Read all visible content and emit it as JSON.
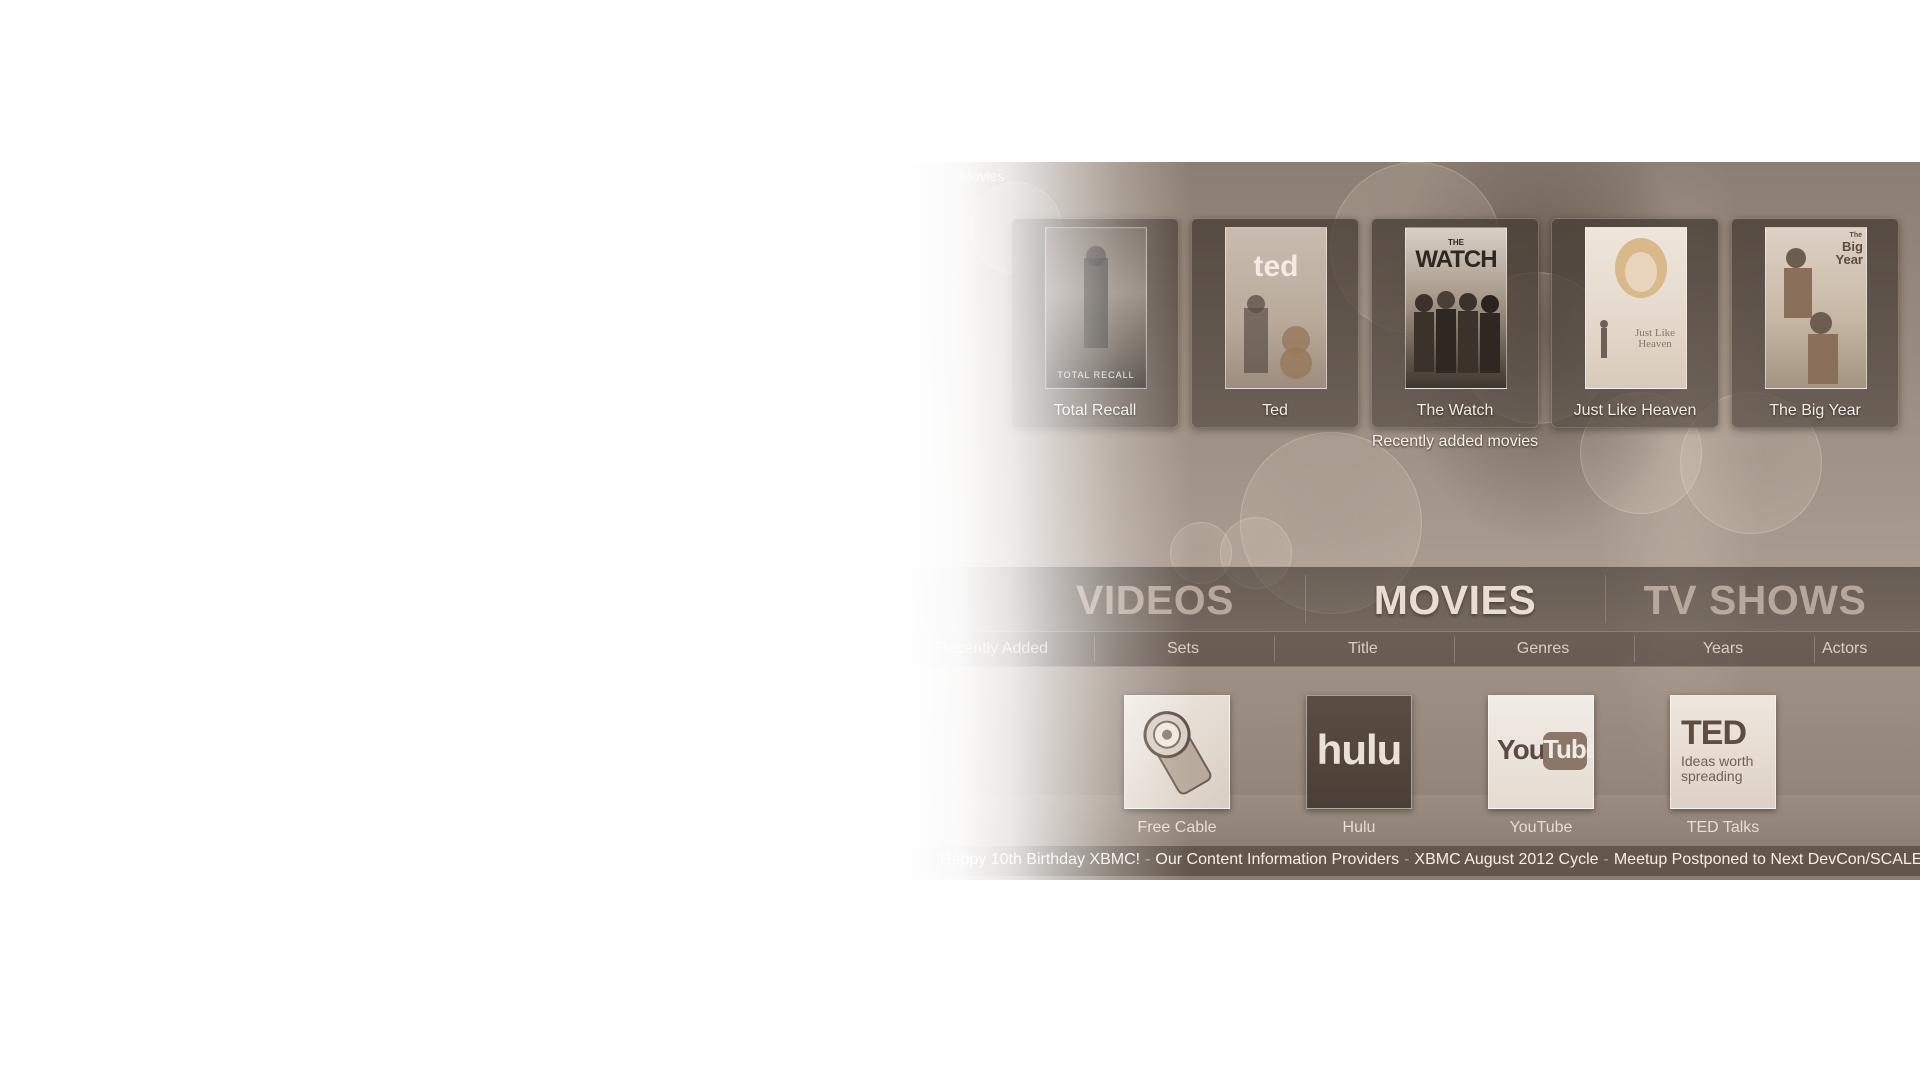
{
  "section_label": "Movies",
  "recently_added": {
    "label": "Recently added movies",
    "items": [
      {
        "title": "Total Recall",
        "poster_text": "TOTAL RECALL"
      },
      {
        "title": "Ted",
        "poster_text": "ted"
      },
      {
        "title": "The Watch",
        "poster_text_top": "THE",
        "poster_text": "WATCH"
      },
      {
        "title": "Just Like Heaven",
        "poster_text": "Just Like Heaven"
      },
      {
        "title": "The Big Year",
        "poster_text_top": "The",
        "poster_text": "Big Year"
      }
    ]
  },
  "main_menu": {
    "items": [
      "VIDEOS",
      "MOVIES",
      "TV SHOWS"
    ],
    "active": "MOVIES"
  },
  "submenu": {
    "items": [
      "Recently Added",
      "Sets",
      "Title",
      "Genres",
      "Years",
      "Actors"
    ]
  },
  "addons": {
    "items": [
      {
        "label": "Free Cable",
        "icon": "camera-lens-icon"
      },
      {
        "label": "Hulu",
        "logo": "hulu"
      },
      {
        "label": "YouTube",
        "logo_left": "You",
        "logo_right": "Tube"
      },
      {
        "label": "TED Talks",
        "logo": "TED",
        "tagline": "Ideas worth spreading"
      }
    ]
  },
  "ticker": {
    "items": [
      "Happy 10th Birthday XBMC!",
      "Our Content Information Providers",
      "XBMC August 2012 Cycle",
      "Meetup Postponed to Next DevCon/SCALE/LinuxFest"
    ],
    "separator": "-"
  },
  "colors": {
    "accent": "#e8ddd0",
    "panel_tone": "#9a8c80"
  }
}
